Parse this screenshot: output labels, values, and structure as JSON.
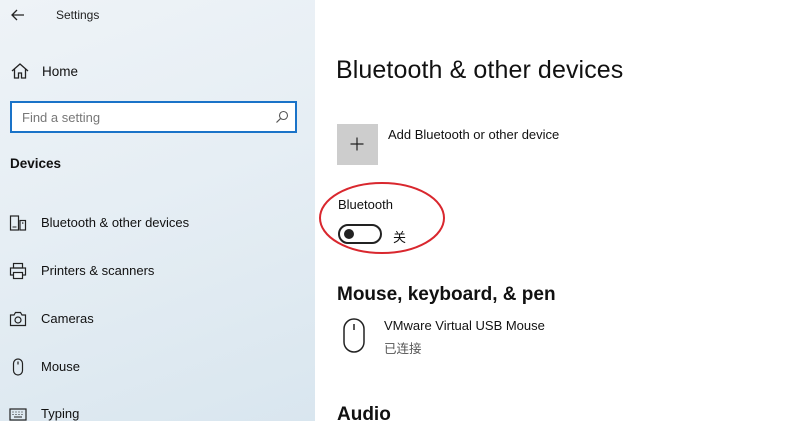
{
  "window": {
    "title": "Settings"
  },
  "sidebar": {
    "home_label": "Home",
    "search": {
      "placeholder": "Find a setting",
      "value": ""
    },
    "section_title": "Devices",
    "items": [
      {
        "label": "Bluetooth & other devices",
        "icon": "devices-icon"
      },
      {
        "label": "Printers & scanners",
        "icon": "printer-icon"
      },
      {
        "label": "Cameras",
        "icon": "camera-icon"
      },
      {
        "label": "Mouse",
        "icon": "mouse-icon"
      },
      {
        "label": "Typing",
        "icon": "keyboard-icon"
      }
    ]
  },
  "main": {
    "title": "Bluetooth & other devices",
    "add_device_label": "Add Bluetooth or other device",
    "bluetooth": {
      "label": "Bluetooth",
      "state_label": "关",
      "on": false
    },
    "mouse_section": {
      "heading": "Mouse, keyboard, & pen",
      "devices": [
        {
          "name": "VMware Virtual USB Mouse",
          "status": "已连接",
          "icon": "mouse-icon"
        }
      ]
    },
    "audio_heading": "Audio"
  },
  "colors": {
    "accent": "#1a73c8",
    "highlight": "#d9272e",
    "tile": "#cdcdcd",
    "sidebar_bg": "#e6eef4"
  }
}
